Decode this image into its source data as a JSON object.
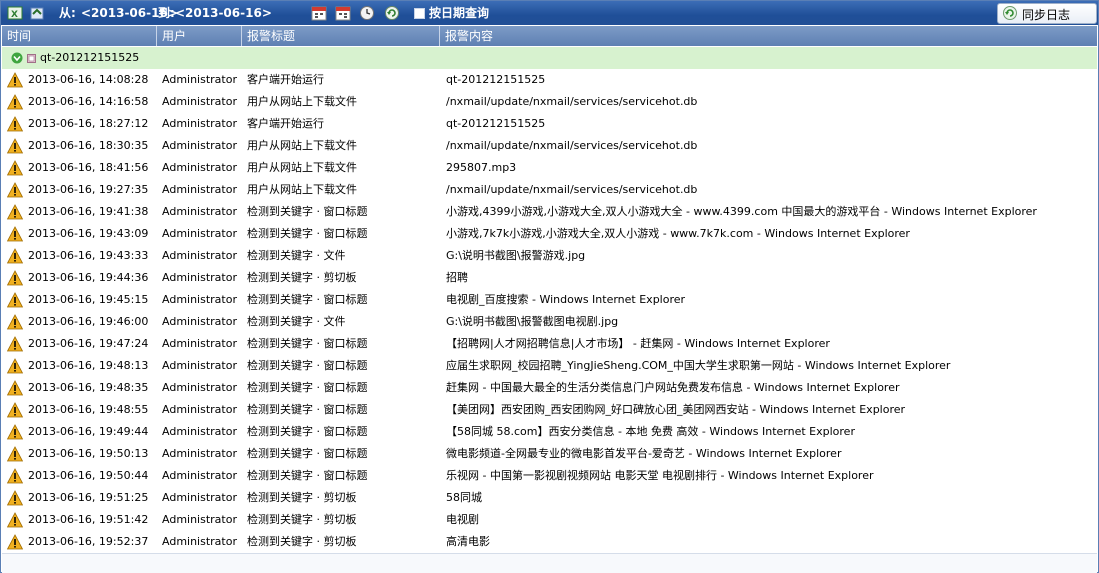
{
  "toolbar": {
    "from_label": "从:",
    "from_date": "<2013-06-16>",
    "to_label": "到:",
    "to_date": "<2013-06-16>",
    "query_by_date_label": "按日期查询",
    "sync_log_label": "同步日志",
    "icons": [
      "export-excel-icon",
      "import-icon",
      "calendar-from-icon",
      "calendar-to-icon",
      "clock-icon",
      "refresh-icon",
      "sync-icon"
    ]
  },
  "table": {
    "columns": [
      "时间",
      "用户",
      "报警标题",
      "报警内容"
    ],
    "group_label": "qt-201212151525",
    "rows": [
      {
        "time": "2013-06-16, 14:08:28",
        "user": "Administrator",
        "title": "客户端开始运行",
        "content": "qt-201212151525"
      },
      {
        "time": "2013-06-16, 14:16:58",
        "user": "Administrator",
        "title": "用户从网站上下载文件",
        "content": "/nxmail/update/nxmail/services/servicehot.db"
      },
      {
        "time": "2013-06-16, 18:27:12",
        "user": "Administrator",
        "title": "客户端开始运行",
        "content": "qt-201212151525"
      },
      {
        "time": "2013-06-16, 18:30:35",
        "user": "Administrator",
        "title": "用户从网站上下载文件",
        "content": "/nxmail/update/nxmail/services/servicehot.db"
      },
      {
        "time": "2013-06-16, 18:41:56",
        "user": "Administrator",
        "title": "用户从网站上下载文件",
        "content": "295807.mp3"
      },
      {
        "time": "2013-06-16, 19:27:35",
        "user": "Administrator",
        "title": "用户从网站上下载文件",
        "content": "/nxmail/update/nxmail/services/servicehot.db"
      },
      {
        "time": "2013-06-16, 19:41:38",
        "user": "Administrator",
        "title": "检测到关键字 · 窗口标题",
        "content": "小游戏,4399小游戏,小游戏大全,双人小游戏大全 - www.4399.com 中国最大的游戏平台 - Windows Internet Explorer"
      },
      {
        "time": "2013-06-16, 19:43:09",
        "user": "Administrator",
        "title": "检测到关键字 · 窗口标题",
        "content": "小游戏,7k7k小游戏,小游戏大全,双人小游戏 - www.7k7k.com - Windows Internet Explorer"
      },
      {
        "time": "2013-06-16, 19:43:33",
        "user": "Administrator",
        "title": "检测到关键字 · 文件",
        "content": "G:\\说明书截图\\报警游戏.jpg"
      },
      {
        "time": "2013-06-16, 19:44:36",
        "user": "Administrator",
        "title": "检测到关键字 · 剪切板",
        "content": "招聘"
      },
      {
        "time": "2013-06-16, 19:45:15",
        "user": "Administrator",
        "title": "检测到关键字 · 窗口标题",
        "content": "电视剧_百度搜索 - Windows Internet Explorer"
      },
      {
        "time": "2013-06-16, 19:46:00",
        "user": "Administrator",
        "title": "检测到关键字 · 文件",
        "content": "G:\\说明书截图\\报警截图电视剧.jpg"
      },
      {
        "time": "2013-06-16, 19:47:24",
        "user": "Administrator",
        "title": "检测到关键字 · 窗口标题",
        "content": "【招聘网|人才网招聘信息|人才市场】 - 赶集网 - Windows Internet Explorer"
      },
      {
        "time": "2013-06-16, 19:48:13",
        "user": "Administrator",
        "title": "检测到关键字 · 窗口标题",
        "content": "应届生求职网_校园招聘_YingJieSheng.COM_中国大学生求职第一网站 - Windows Internet Explorer"
      },
      {
        "time": "2013-06-16, 19:48:35",
        "user": "Administrator",
        "title": "检测到关键字 · 窗口标题",
        "content": "赶集网 - 中国最大最全的生活分类信息门户网站免费发布信息 - Windows Internet Explorer"
      },
      {
        "time": "2013-06-16, 19:48:55",
        "user": "Administrator",
        "title": "检测到关键字 · 窗口标题",
        "content": "【美团网】西安团购_西安团购网_好口碑放心团_美团网西安站 - Windows Internet Explorer"
      },
      {
        "time": "2013-06-16, 19:49:44",
        "user": "Administrator",
        "title": "检测到关键字 · 窗口标题",
        "content": "【58同城 58.com】西安分类信息 - 本地 免费 高效 - Windows Internet Explorer"
      },
      {
        "time": "2013-06-16, 19:50:13",
        "user": "Administrator",
        "title": "检测到关键字 · 窗口标题",
        "content": "微电影频道-全网最专业的微电影首发平台-爱奇艺 - Windows Internet Explorer"
      },
      {
        "time": "2013-06-16, 19:50:44",
        "user": "Administrator",
        "title": "检测到关键字 · 窗口标题",
        "content": "乐视网 - 中国第一影视剧视频网站 电影天堂 电视剧排行 - Windows Internet Explorer"
      },
      {
        "time": "2013-06-16, 19:51:25",
        "user": "Administrator",
        "title": "检测到关键字 · 剪切板",
        "content": "58同城"
      },
      {
        "time": "2013-06-16, 19:51:42",
        "user": "Administrator",
        "title": "检测到关键字 · 剪切板",
        "content": "电视剧"
      },
      {
        "time": "2013-06-16, 19:52:37",
        "user": "Administrator",
        "title": "检测到关键字 · 剪切板",
        "content": "高清电影"
      }
    ]
  },
  "colors": {
    "toolbar_bg": "#2453a0",
    "header_bg": "#6d8ebf",
    "group_bg": "#d7f2cf",
    "warning_icon": "#f0b020"
  }
}
